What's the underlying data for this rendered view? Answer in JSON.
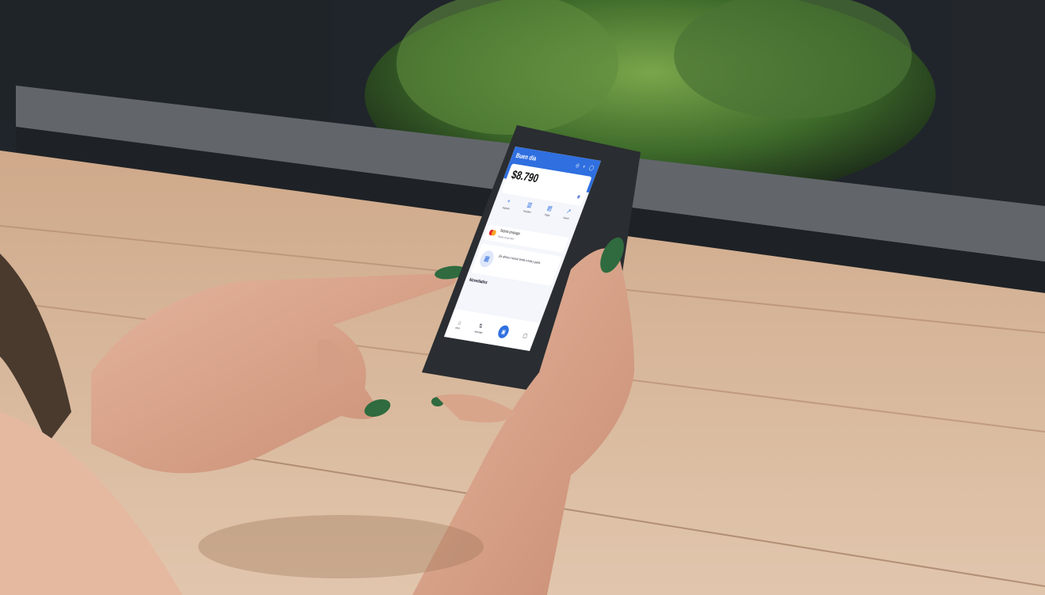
{
  "app": {
    "greeting": "Buen día",
    "balance": "$8.790",
    "header_icons": [
      "bell-icon",
      "share-icon",
      "user-icon"
    ],
    "actions": [
      {
        "icon": "plus-icon",
        "label": "Ingresar"
      },
      {
        "icon": "bank-icon",
        "label": "Transferir"
      },
      {
        "icon": "receipt-icon",
        "label": "Pagar"
      },
      {
        "icon": "chart-icon",
        "label": "Invertir"
      }
    ],
    "card": {
      "title": "Tarjeta prepaga",
      "subtitle": "Tarjeta virtual 0000"
    },
    "promo": {
      "text": "¡Es ahora o nunca! Invitá a más y ganá."
    },
    "news_title": "Novedades",
    "nav": [
      {
        "icon": "home-icon",
        "label": "Inicio"
      },
      {
        "icon": "activity-icon",
        "label": "Actividad"
      },
      {
        "icon": "qr-icon",
        "label": ""
      },
      {
        "icon": "wallet-icon",
        "label": ""
      }
    ]
  }
}
